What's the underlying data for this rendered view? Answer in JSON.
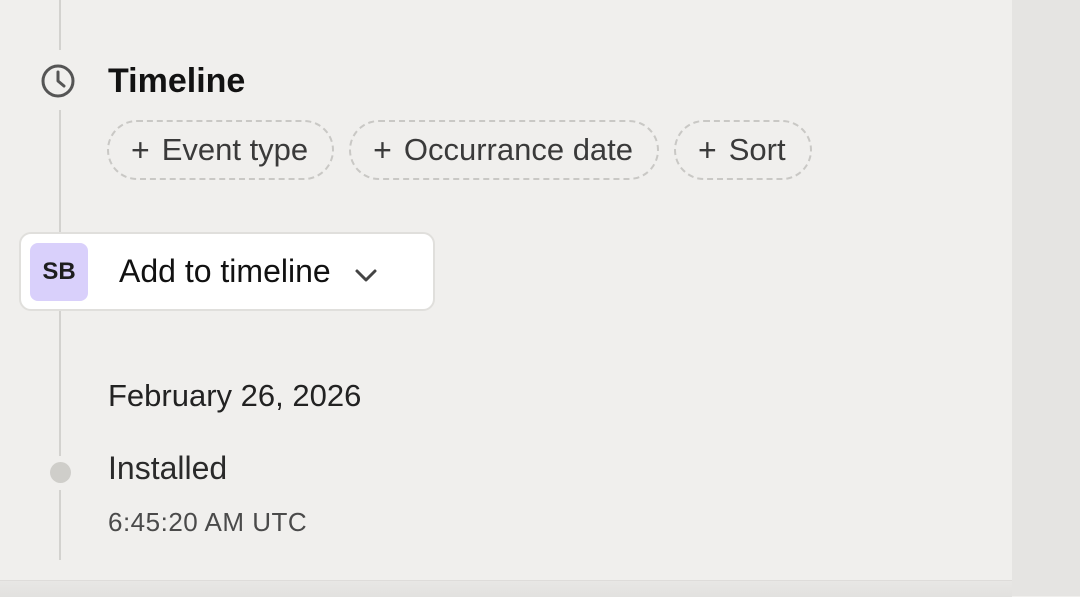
{
  "timeline": {
    "title": "Timeline",
    "filters": [
      {
        "label": "Event type"
      },
      {
        "label": "Occurrance date"
      },
      {
        "label": "Sort"
      }
    ]
  },
  "add_to_timeline": {
    "avatar_initials": "SB",
    "label": "Add to timeline",
    "avatar_color": "#d9d0fb"
  },
  "events_group": {
    "date": "February 26, 2026",
    "events": [
      {
        "title": "Installed",
        "time": "6:45:20 AM UTC"
      }
    ]
  },
  "icons": {
    "section": "clock-icon",
    "filter_add": "plus-icon",
    "dropdown": "chevron-down-icon"
  }
}
